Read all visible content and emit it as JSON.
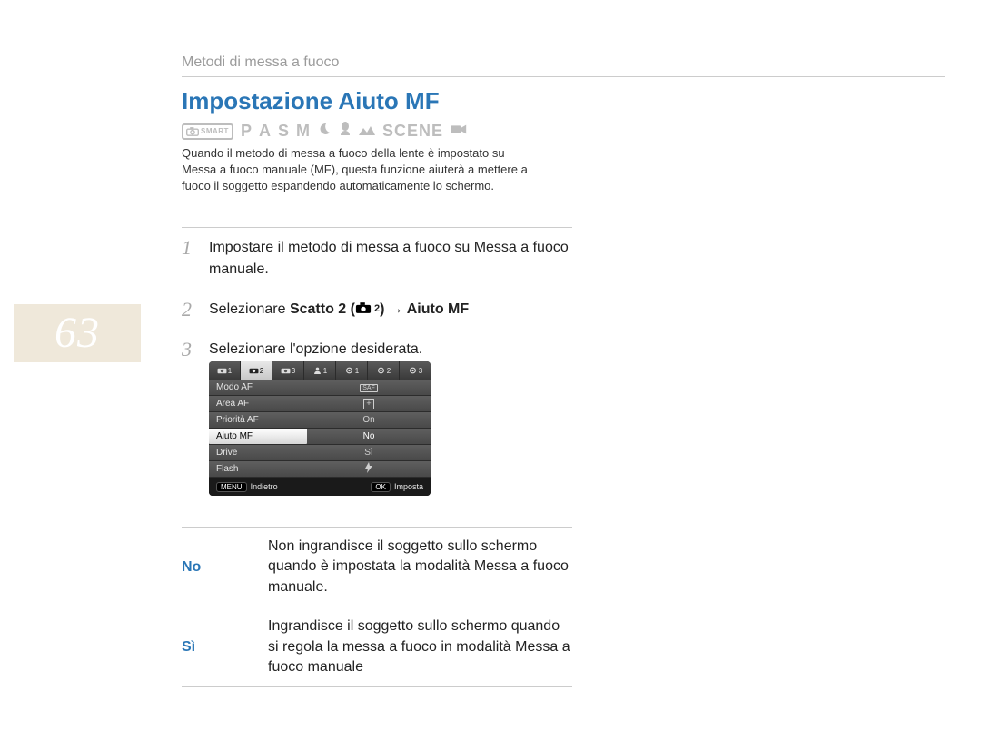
{
  "header": {
    "section": "Metodi di messa a fuoco"
  },
  "page_number": "63",
  "title": "Impostazione Aiuto MF",
  "mode_row": {
    "smart_label": "SMART",
    "letters": [
      "P",
      "A",
      "S",
      "M"
    ],
    "scene_label": "SCENE"
  },
  "intro": "Quando il metodo di messa a fuoco della lente è impostato su Messa a fuoco manuale (MF), questa funzione aiuterà a mettere a fuoco il soggetto espandendo automaticamente lo schermo.",
  "steps": [
    {
      "num": "1",
      "text": "Impostare il metodo di messa a fuoco su Messa a fuoco manuale."
    },
    {
      "num": "2",
      "prefix": "Selezionare ",
      "bold1": "Scatto 2 (",
      "icon_sub": "2",
      "bold2": ") → Aiuto MF"
    },
    {
      "num": "3",
      "text": "Selezionare l'opzione desiderata."
    }
  ],
  "menu": {
    "tabs_cam": [
      "1",
      "2",
      "3"
    ],
    "tabs_user": [
      "1"
    ],
    "tabs_gear": [
      "1",
      "2",
      "3"
    ],
    "rows": [
      {
        "label": "Modo AF",
        "value_type": "saf",
        "value": "SAF"
      },
      {
        "label": "Area AF",
        "value_type": "plus",
        "value": "+"
      },
      {
        "label": "Priorità AF",
        "value_type": "text",
        "value": "On"
      },
      {
        "label": "Aiuto MF",
        "value_type": "text",
        "value": "No",
        "selected": true
      },
      {
        "label": "Drive",
        "value_type": "text",
        "value": "Sì"
      },
      {
        "label": "Flash",
        "value_type": "flash",
        "value": ""
      }
    ],
    "footer": {
      "back_pill": "MENU",
      "back_label": "Indietro",
      "ok_pill": "OK",
      "ok_label": "Imposta"
    }
  },
  "options": [
    {
      "key": "No",
      "desc": "Non ingrandisce il soggetto sullo schermo quando è impostata la modalità Messa a fuoco manuale."
    },
    {
      "key": "Sì",
      "desc": "Ingrandisce il soggetto sullo schermo quando si regola la messa a fuoco in modalità Messa a fuoco manuale"
    }
  ]
}
